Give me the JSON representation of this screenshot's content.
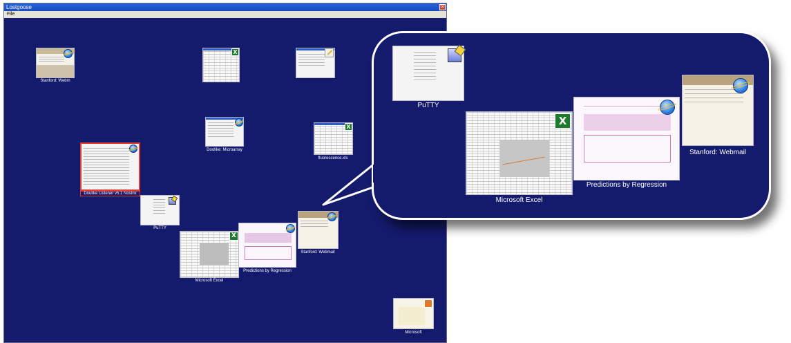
{
  "window": {
    "title": "Lostgoose",
    "close_glyph": "✕"
  },
  "menu": {
    "items": [
      "File"
    ]
  },
  "desktop": {
    "captions": {
      "stanford_webmail_top": "Stanford: Webm",
      "doulike_microarray": "Doolike: Microarray",
      "fluorescence": "fluorescence.xls",
      "doulike_listener": "Doulike Listener v5.1 Nostrix",
      "putty": "PuTTY",
      "microsoft_excel": "Microsoft Excel",
      "predictions": "Predictions by Regression",
      "stanford_webmail": "Stanford: Webmail",
      "microsoft": "Microsoft"
    }
  },
  "callout": {
    "captions": {
      "putty": "PuTTY",
      "microsoft_excel": "Microsoft Excel",
      "predictions": "Predictions by Regression",
      "stanford_webmail": "Stanford: Webmail"
    }
  },
  "icons": {
    "excel_letter": "X",
    "ie": "internet-explorer-icon",
    "excel": "excel-icon",
    "putty": "putty-icon",
    "editor": "editor-icon",
    "powerpoint": "powerpoint-icon"
  },
  "colors": {
    "desktop_bg": "#141a6c",
    "selection": "#e43c30",
    "titlebar": "#1a4bc0"
  }
}
